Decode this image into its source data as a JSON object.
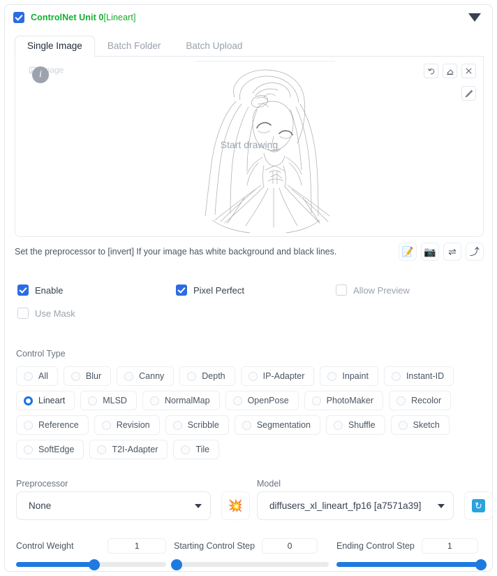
{
  "header": {
    "title_main": "ControlNet Unit 0",
    "title_sub": "[Lineart]",
    "enabled": true,
    "collapse_icon": "caret-down-icon",
    "accent_green": "#12b030",
    "accent_blue": "#2b6ce5"
  },
  "tabs": [
    {
      "label": "Single Image",
      "active": true
    },
    {
      "label": "Batch Folder",
      "active": false
    },
    {
      "label": "Batch Upload",
      "active": false
    }
  ],
  "canvas": {
    "chip_label": "Image",
    "chip_icon": "image-icon",
    "info_icon": "info-icon",
    "placeholder": "Start drawing",
    "top_right_tools": [
      {
        "name": "undo-button",
        "icon": "undo-icon"
      },
      {
        "name": "eraser-button",
        "icon": "eraser-icon"
      },
      {
        "name": "clear-button",
        "icon": "close-icon"
      }
    ],
    "second_row_tools": [
      {
        "name": "brush-button",
        "icon": "brush-icon"
      }
    ]
  },
  "hint": {
    "text": "Set the preprocessor to [invert] If your image has white background and black lines.",
    "actions": [
      {
        "name": "open-new-canvas-button",
        "icon": "edit-document-icon",
        "glyph": "📝"
      },
      {
        "name": "webcam-button",
        "icon": "camera-icon",
        "glyph": "📷"
      },
      {
        "name": "mirror-webcam-button",
        "icon": "swap-arrows-icon",
        "glyph": "⇌"
      },
      {
        "name": "send-dimensions-button",
        "icon": "curved-arrow-icon",
        "glyph": "⤴"
      }
    ]
  },
  "checkboxes": [
    {
      "label": "Enable",
      "checked": true
    },
    {
      "label": "Pixel Perfect",
      "checked": true
    },
    {
      "label": "Allow Preview",
      "checked": false
    },
    {
      "label": "Use Mask",
      "checked": false
    }
  ],
  "control_type": {
    "label": "Control Type",
    "selected": "Lineart",
    "rows": [
      [
        "All",
        "Blur",
        "Canny",
        "Depth",
        "IP-Adapter",
        "Inpaint",
        "Instant-ID"
      ],
      [
        "Lineart",
        "MLSD",
        "NormalMap",
        "OpenPose",
        "PhotoMaker",
        "Recolor"
      ],
      [
        "Reference",
        "Revision",
        "Scribble",
        "Segmentation",
        "Shuffle",
        "Sketch"
      ],
      [
        "SoftEdge",
        "T2I-Adapter",
        "Tile"
      ]
    ]
  },
  "preprocessor": {
    "label": "Preprocessor",
    "value": "None",
    "run_button_icon": "explosion-icon",
    "run_button_glyph": "💥"
  },
  "model": {
    "label": "Model",
    "value": "diffusers_xl_lineart_fp16 [a7571a39]",
    "refresh_icon": "refresh-icon",
    "refresh_glyph": "↻"
  },
  "sliders": [
    {
      "label": "Control Weight",
      "value": "1",
      "percent": 52
    },
    {
      "label": "Starting Control Step",
      "value": "0",
      "percent": 0
    },
    {
      "label": "Ending Control Step",
      "value": "1",
      "percent": 100
    }
  ]
}
